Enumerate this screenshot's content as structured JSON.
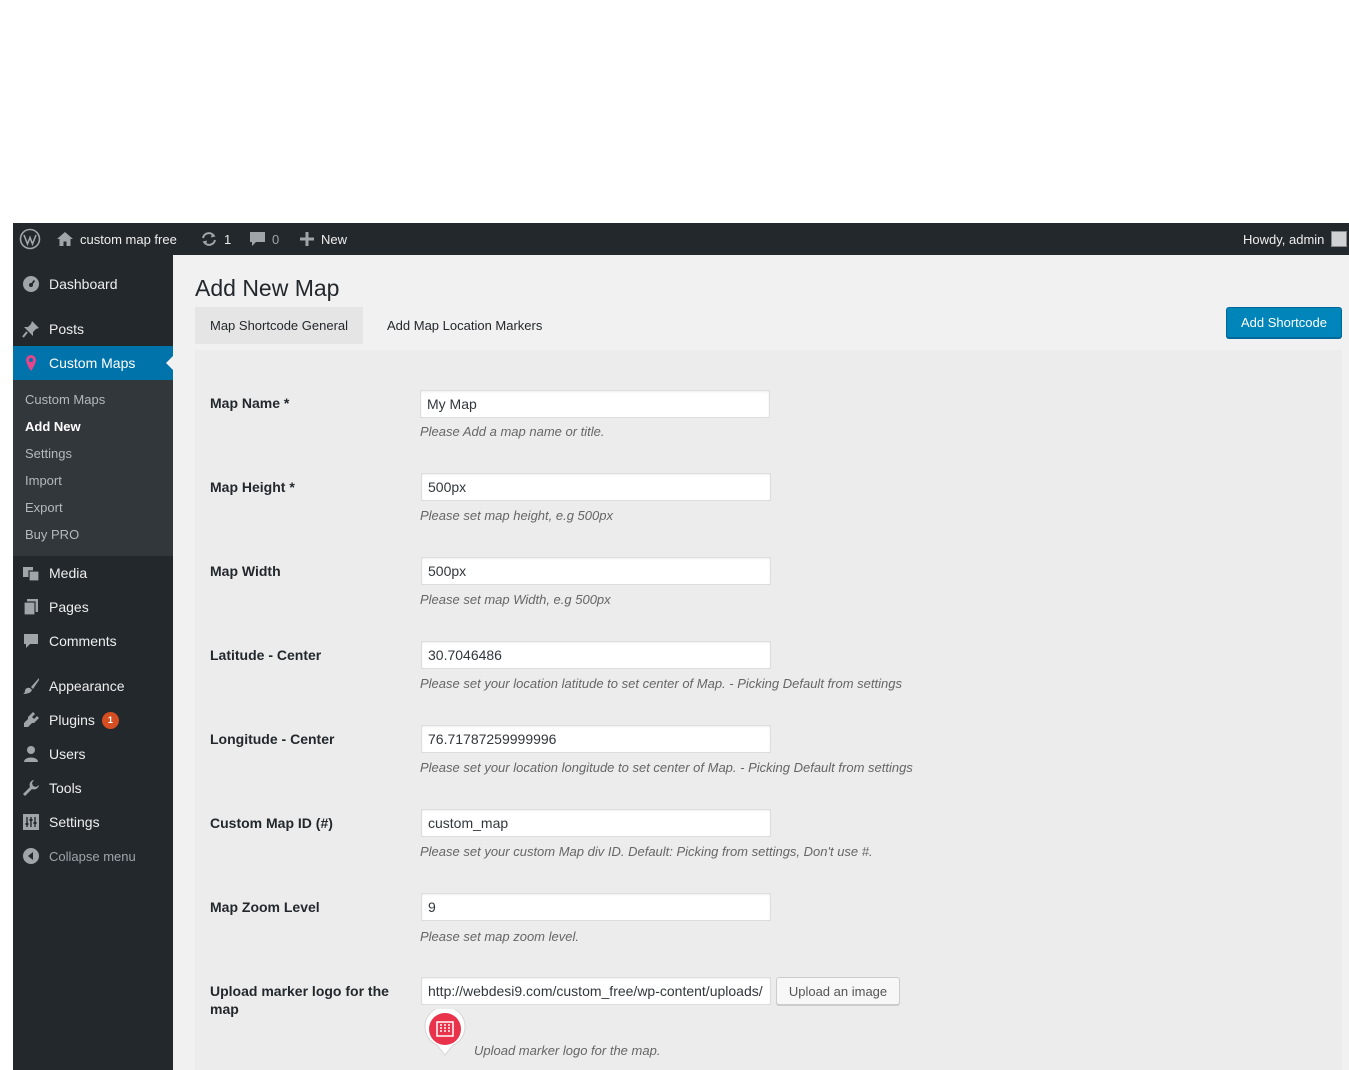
{
  "adminbar": {
    "site_name": "custom map free",
    "updates_count": "1",
    "comments_count": "0",
    "new_label": "New",
    "howdy": "Howdy, admin"
  },
  "sidebar": {
    "items": [
      {
        "label": "Dashboard",
        "icon": "dashboard-icon"
      },
      {
        "label": "Posts",
        "icon": "pushpin-icon"
      },
      {
        "label": "Custom Maps",
        "icon": "map-pin-icon"
      },
      {
        "label": "Media",
        "icon": "media-icon"
      },
      {
        "label": "Pages",
        "icon": "pages-icon"
      },
      {
        "label": "Comments",
        "icon": "comment-icon"
      },
      {
        "label": "Appearance",
        "icon": "brush-icon"
      },
      {
        "label": "Plugins",
        "icon": "plugin-icon",
        "badge": "1"
      },
      {
        "label": "Users",
        "icon": "user-icon"
      },
      {
        "label": "Tools",
        "icon": "wrench-icon"
      },
      {
        "label": "Settings",
        "icon": "settings-icon"
      }
    ],
    "submenu": [
      "Custom Maps",
      "Add New",
      "Settings",
      "Import",
      "Export",
      "Buy PRO"
    ],
    "collapse_label": "Collapse menu"
  },
  "page": {
    "title": "Add New Map",
    "tabs": [
      "Map Shortcode General",
      "Add Map Location Markers"
    ],
    "add_shortcode_label": "Add Shortcode"
  },
  "form": {
    "fields": [
      {
        "label": "Map Name *",
        "value": "My Map",
        "description": "Please Add a map name or title."
      },
      {
        "label": "Map Height *",
        "value": "500px",
        "description": "Please set map height, e.g 500px"
      },
      {
        "label": "Map Width",
        "value": "500px",
        "description": "Please set map Width, e.g 500px"
      },
      {
        "label": "Latitude - Center",
        "value": "30.7046486",
        "description": "Please set your location latitude to set center of Map. - Picking Default from settings"
      },
      {
        "label": "Longitude - Center",
        "value": "76.71787259999996",
        "description": "Please set your location longitude to set center of Map. - Picking Default from settings"
      },
      {
        "label": "Custom Map ID (#)",
        "value": "custom_map",
        "description": "Please set your custom Map div ID. Default: Picking from settings, Don't use #."
      },
      {
        "label": "Map Zoom Level",
        "value": "9",
        "description": "Please set map zoom level."
      },
      {
        "label": "Upload marker logo for the map",
        "value": "http://webdesi9.com/custom_free/wp-content/uploads/",
        "description": "Upload marker logo for the map."
      }
    ],
    "upload_button_label": "Upload an image"
  },
  "colors": {
    "adminbar_bg": "#23282d",
    "menu_current": "#0073aa",
    "primary_button": "#0085ba",
    "badge": "#d54e21",
    "marker": "#e8334a"
  }
}
